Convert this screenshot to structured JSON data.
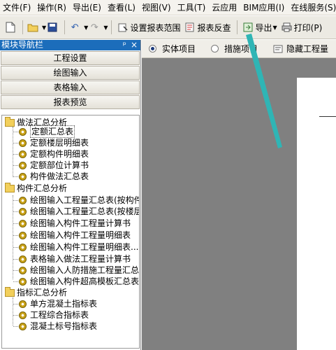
{
  "menu": [
    "文件(F)",
    "操作(R)",
    "导出(E)",
    "查看(L)",
    "视图(V)",
    "工具(T)",
    "云应用",
    "BIM应用(I)",
    "在线服务(S)"
  ],
  "toolbar": {
    "set_range": "设置报表范围",
    "check": "报表反查",
    "export": "导出",
    "print": "打印(P)"
  },
  "nav_panel": {
    "title": "模块导航栏",
    "pin": "ᵖ",
    "close": "×",
    "buttons": [
      "工程设置",
      "绘图输入",
      "表格输入",
      "报表预览"
    ]
  },
  "options": {
    "entity": "实体项目",
    "measure": "措施项目",
    "hide": "隐藏工程量"
  },
  "tree": {
    "groups": [
      {
        "label": "做法汇总分析",
        "items": [
          "定额汇总表",
          "定额楼层明细表",
          "定额构件明细表",
          "定额部位计算书",
          "构件做法汇总表"
        ]
      },
      {
        "label": "构件汇总分析",
        "items": [
          "绘图输入工程量汇总表(按构件)",
          "绘图输入工程量汇总表(按楼层)",
          "绘图输入构件工程量计算书",
          "绘图输入构件工程量明细表",
          "绘图输入构件工程量明细表...",
          "表格输入做法工程量计算书",
          "绘图输入人防措施工程量汇总表",
          "绘图输入构件超高模板汇总表"
        ]
      },
      {
        "label": "指标汇总分析",
        "items": [
          "单方混凝土指标表",
          "工程综合指标表",
          "混凝土标号指标表"
        ]
      }
    ]
  },
  "colors": {
    "pane_header": "#1c6dbb",
    "workspace": "#808080",
    "pointer": "#2fb5b5"
  }
}
